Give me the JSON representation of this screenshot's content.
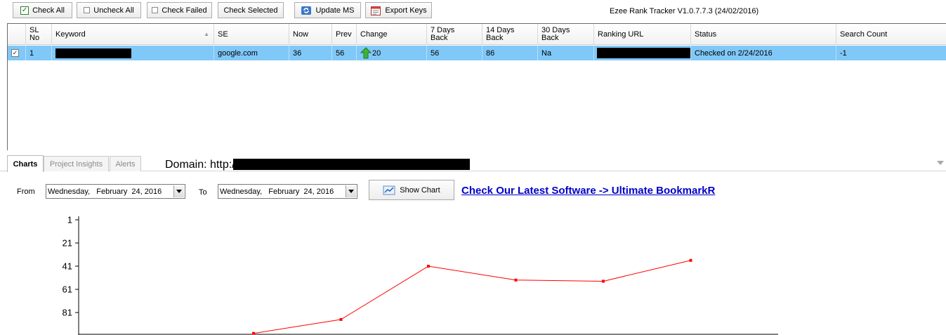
{
  "toolbar": {
    "check_all": "Check All",
    "uncheck_all": "Uncheck All",
    "check_failed": "Check Failed",
    "check_selected": "Check Selected",
    "update_ms": "Update MS",
    "export_keys": "Export Keys",
    "app_title": "Ezee Rank Tracker V1.0.7.7.3 (24/02/2016)"
  },
  "grid": {
    "headers": {
      "sl": "SL",
      "sl2": "No",
      "keyword": "Keyword",
      "se": "SE",
      "now": "Now",
      "prev": "Prev",
      "change": "Change",
      "d7a": "7 Days",
      "d7b": "Back",
      "d14a": "14 Days",
      "d14b": "Back",
      "d30a": "30 Days",
      "d30b": "Back",
      "ranking_url": "Ranking URL",
      "status": "Status",
      "search_count": "Search Count"
    },
    "row": {
      "checked": "✓",
      "sl": "1",
      "se": "google.com",
      "now": "36",
      "prev": "56",
      "change": "20",
      "d7": "56",
      "d14": "86",
      "d30": "Na",
      "status": "Checked on 2/24/2016",
      "search_count": "-1"
    }
  },
  "tabs": {
    "charts": "Charts",
    "insights": "Project Insights",
    "alerts": "Alerts"
  },
  "domain_label": "Domain: http:/",
  "dates": {
    "from_label": "From",
    "to_label": "To",
    "from_value": "Wednesday,   February  24, 2016",
    "to_value": "Wednesday,   February  24, 2016"
  },
  "show_chart": "Show Chart",
  "promo": "Check Our Latest Software -> Ultimate BookmarkR ",
  "colors": {
    "selected_row": "#80c8f8",
    "series_line": "#ff0000",
    "promo_link": "#0000c8"
  },
  "chart_data": {
    "type": "line",
    "y_ticks": [
      "1",
      "21",
      "41",
      "61",
      "81"
    ],
    "ylim": [
      1,
      100
    ],
    "y_inverted": true,
    "grid": false,
    "series": [
      {
        "values": [
          null,
          null,
          99,
          87,
          41,
          53,
          54,
          36
        ]
      }
    ]
  }
}
